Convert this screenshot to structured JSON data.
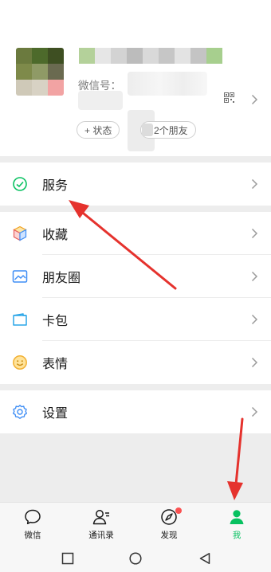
{
  "profile": {
    "wechat_id_label": "微信号：",
    "status_label": "+ 状态",
    "friends_label": "2个朋友"
  },
  "menu": {
    "service": "服务",
    "favorites": "收藏",
    "moments": "朋友圈",
    "cards": "卡包",
    "stickers": "表情",
    "settings": "设置"
  },
  "tabbar": {
    "chats": "微信",
    "contacts": "通讯录",
    "discover": "发现",
    "me": "我"
  },
  "colors": {
    "accent_green": "#07c160",
    "badge_red": "#fa5151",
    "annotation_red": "#e5322d",
    "page_gray": "#ededed"
  },
  "icons": [
    "service-icon",
    "favorites-icon",
    "moments-icon",
    "cards-icon",
    "stickers-icon",
    "settings-icon",
    "qr-code-icon",
    "chevron-right-icon",
    "chat-bubble-icon",
    "contacts-icon",
    "compass-icon",
    "person-icon",
    "square-nav-icon",
    "circle-nav-icon",
    "back-triangle-icon"
  ]
}
